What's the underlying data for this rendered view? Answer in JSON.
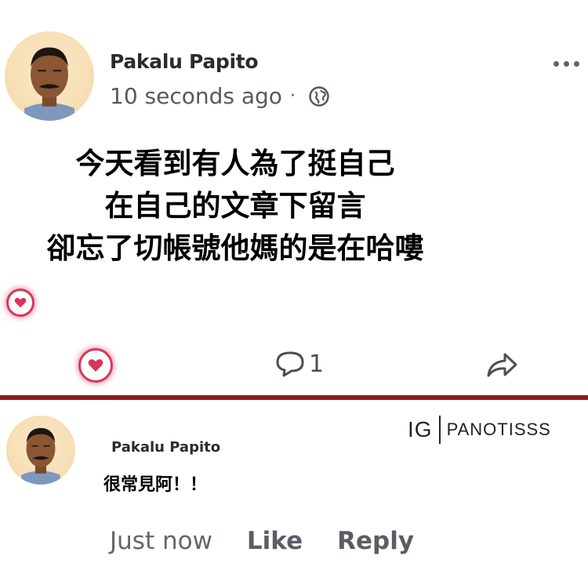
{
  "post": {
    "author": "Pakalu Papito",
    "time": "10 seconds ago",
    "separator": "·",
    "text_lines": [
      "今天看到有人為了挺自己",
      "在自己的文章下留言",
      "卻忘了切帳號他媽的是在哈嘍"
    ],
    "comment_count": "1"
  },
  "comment": {
    "author": "Pakalu Papito",
    "text": "很常見阿！！",
    "time": "Just now",
    "like_label": "Like",
    "reply_label": "Reply"
  },
  "watermark": {
    "prefix": "IG",
    "handle": "PANOTISSS"
  },
  "colors": {
    "heart": "#d6365a",
    "divider": "#8b1a1a"
  }
}
